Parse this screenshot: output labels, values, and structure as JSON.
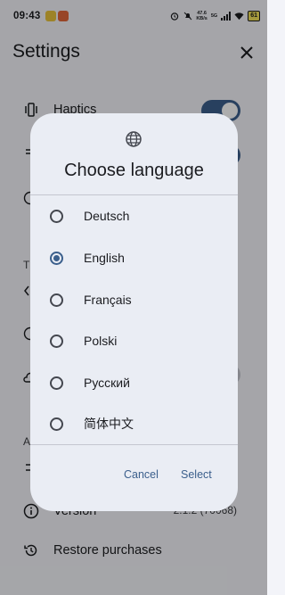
{
  "status_bar": {
    "time": "09:43",
    "net_speed": "47.6\nKB/s",
    "signal_label": "5G",
    "battery": "61"
  },
  "background": {
    "title": "Settings",
    "haptics_label": "Haptics",
    "partial_t": "T",
    "partial_a": "A",
    "version_label": "Version",
    "version_value": "2.1.2 (70068)",
    "restore_label": "Restore purchases"
  },
  "dialog": {
    "title": "Choose language",
    "options": [
      {
        "label": "Deutsch",
        "selected": false
      },
      {
        "label": "English",
        "selected": true
      },
      {
        "label": "Français",
        "selected": false
      },
      {
        "label": "Polski",
        "selected": false
      },
      {
        "label": "Русский",
        "selected": false
      },
      {
        "label": "简体中文",
        "selected": false
      }
    ],
    "cancel_label": "Cancel",
    "select_label": "Select"
  },
  "colors": {
    "accent": "#3b5f8c",
    "dialog_bg": "#eaedf4",
    "page_bg": "#f3f4f9"
  }
}
